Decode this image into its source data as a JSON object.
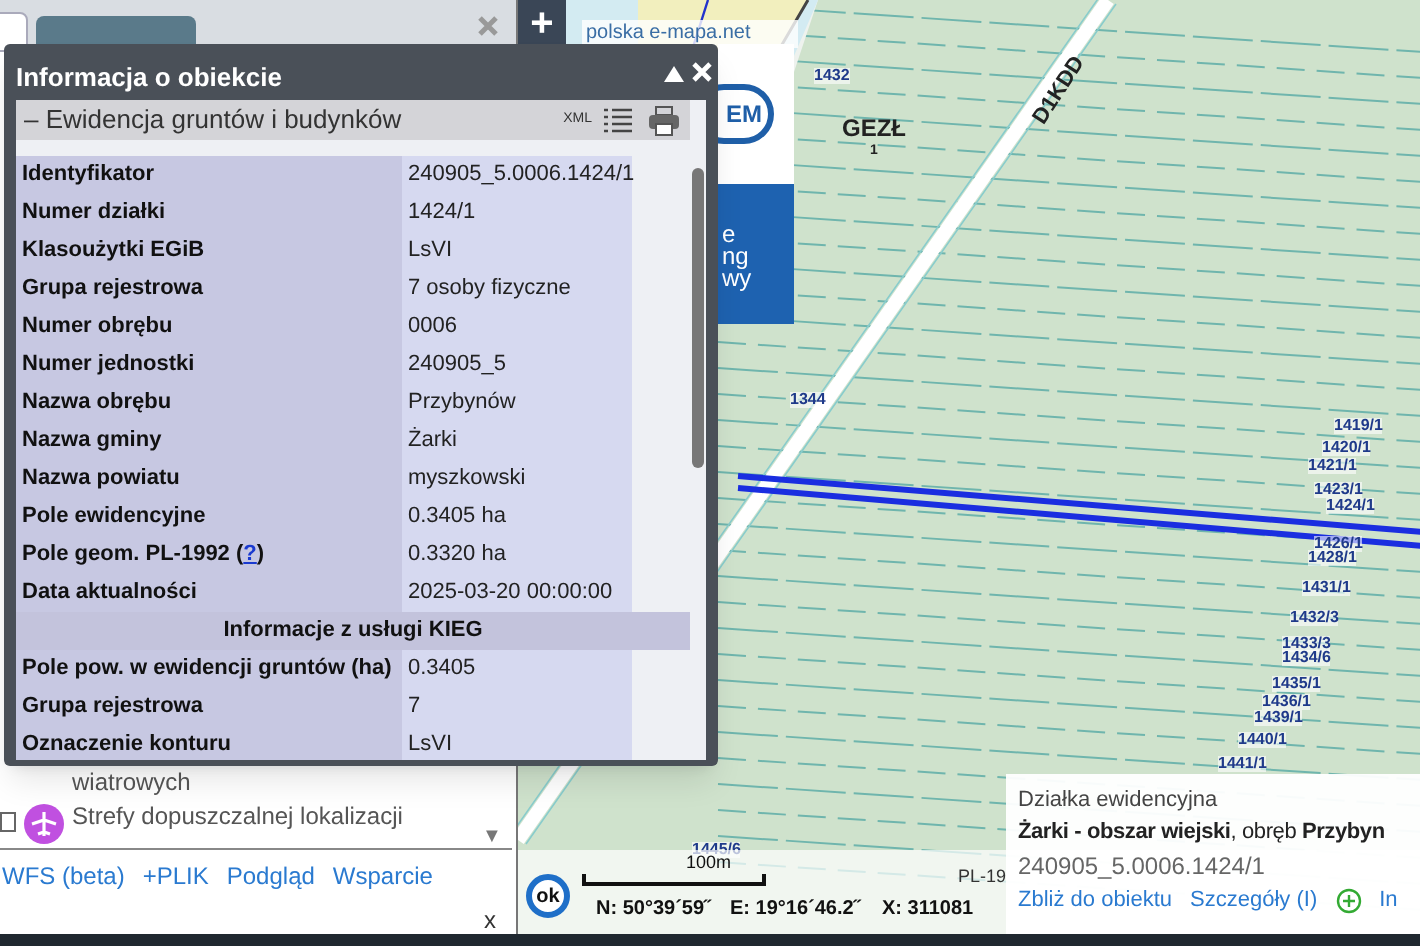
{
  "window": {
    "title": "Informacja o obiekcie"
  },
  "section": {
    "title": "Ewidencja gruntów i budynków",
    "collapse_symbol": "–",
    "xml_label": "XML"
  },
  "rows": [
    {
      "kind": "row",
      "label": "Identyfikator",
      "value": "240905_5.0006.1424/1"
    },
    {
      "kind": "row",
      "label": "Numer działki",
      "value": "1424/1"
    },
    {
      "kind": "row",
      "label": "Klasoużytki EGiB",
      "value": "LsVI"
    },
    {
      "kind": "row",
      "label": "Grupa rejestrowa",
      "value": "7 osoby fizyczne"
    },
    {
      "kind": "row",
      "label": "Numer obrębu",
      "value": "0006"
    },
    {
      "kind": "row",
      "label": "Numer jednostki",
      "value": "240905_5"
    },
    {
      "kind": "row",
      "label": "Nazwa obrębu",
      "value": "Przybynów"
    },
    {
      "kind": "row",
      "label": "Nazwa gminy",
      "value": "Żarki"
    },
    {
      "kind": "row",
      "label": "Nazwa powiatu",
      "value": "myszkowski"
    },
    {
      "kind": "row",
      "label": "Pole ewidencyjne",
      "value": "0.3405 ha"
    },
    {
      "kind": "help_row",
      "label": "Pole geom. PL-1992 (",
      "link": "?",
      "label_end": ")",
      "value": "0.3320 ha"
    },
    {
      "kind": "row",
      "label": "Data aktualności",
      "value": "2025-03-20 00:00:00"
    },
    {
      "kind": "header",
      "label": "Informacje z usługi KIEG"
    },
    {
      "kind": "row",
      "label": "Pole pow. w ewidencji gruntów (ha)",
      "value": "0.3405"
    },
    {
      "kind": "row",
      "label": "Grupa rejestrowa",
      "value": "7"
    },
    {
      "kind": "row",
      "label": "Oznaczenie konturu",
      "value": "LsVI"
    }
  ],
  "layers": [
    {
      "label": "wiatrowych"
    },
    {
      "label": "Strefy dopuszczalnej lokalizacji",
      "checked": false
    }
  ],
  "layers_scroll": "▼",
  "footer_links": [
    "WFS (beta)",
    "+PLIK",
    "Podgląd",
    "Wsparcie"
  ],
  "footer_close": "x",
  "map": {
    "zoom_in": "+",
    "site_label": "polska e-mapa.net",
    "ad_logo": "EM",
    "ad_lines": [
      "e",
      "ng",
      "wy"
    ],
    "labels": [
      "GEZŁ",
      "1",
      "1432",
      "1344",
      "D1KDD",
      "1419/1",
      "1420/1",
      "1421/1",
      "1423/1",
      "1424/1",
      "1426/1",
      "1428/1",
      "1431/1",
      "1432/3",
      "1433/3",
      "1434/6",
      "1435/1",
      "1436/1",
      "1439/1",
      "1440/1",
      "1441/1",
      "1445/6"
    ],
    "scale": "100m",
    "ok": "ok",
    "coords": [
      "N: 50°39´59˝",
      "E: 19°16´46.2˝",
      "X: 311081",
      "PL-19"
    ]
  },
  "info": {
    "type": "Działka ewidencyjna",
    "place": "**Żarki - obszar wiejski**, obręb **Przybyn**",
    "id": "240905_5.0006.1424/1",
    "actions": [
      "Zbliż do obiektu",
      "Szczegóły (I)"
    ],
    "more": "In"
  }
}
